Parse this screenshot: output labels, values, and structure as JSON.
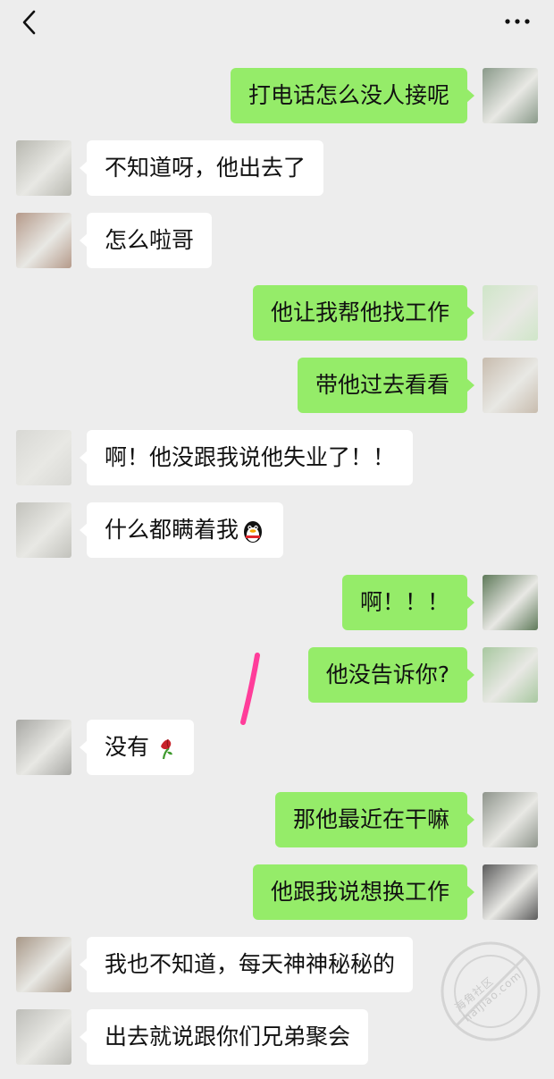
{
  "header": {
    "back_icon": "chevron-left-icon",
    "more_icon": "more-dots-icon"
  },
  "messages": [
    {
      "side": "right",
      "text": "打电话怎么没人接呢",
      "avatar_color": "#8a9a8a"
    },
    {
      "side": "left",
      "text": "不知道呀，他出去了",
      "avatar_color": "#b8b8b0"
    },
    {
      "side": "left",
      "text": "怎么啦哥",
      "avatar_color": "#b59a8a"
    },
    {
      "side": "right",
      "text": "他让我帮他找工作",
      "avatar_color": "#cfe6c8"
    },
    {
      "side": "right",
      "text": "带他过去看看",
      "avatar_color": "#c8bcae"
    },
    {
      "side": "left",
      "text": "啊！他没跟我说他失业了！！",
      "avatar_color": "#d8d8d4"
    },
    {
      "side": "left",
      "text": "什么都瞒着我",
      "emoji": "qq-penguin-emoji",
      "avatar_color": "#c2c2bc"
    },
    {
      "side": "right",
      "text": "啊！！！",
      "avatar_color": "#5f7a5a"
    },
    {
      "side": "right",
      "text": "他没告诉你?",
      "avatar_color": "#a8c8a0"
    },
    {
      "side": "left",
      "text": "没有",
      "emoji": "wilted-rose-emoji",
      "avatar_color": "#a8a8a4"
    },
    {
      "side": "right",
      "text": "那他最近在干嘛",
      "avatar_color": "#8f958c"
    },
    {
      "side": "right",
      "text": "他跟我说想换工作",
      "avatar_color": "#5c5c5c"
    },
    {
      "side": "left",
      "text": "我也不知道，每天神神秘秘的",
      "avatar_color": "#a89888"
    },
    {
      "side": "left",
      "text": "出去就说跟你们兄弟聚会",
      "avatar_color": "#bdbdb8"
    }
  ],
  "watermark": {
    "text_cn": "海角社区",
    "text_en": "haijiao.com"
  },
  "colors": {
    "background": "#ededed",
    "bubble_self": "#95ec69",
    "bubble_other": "#ffffff",
    "annotation_stroke": "#ff3d9a"
  }
}
